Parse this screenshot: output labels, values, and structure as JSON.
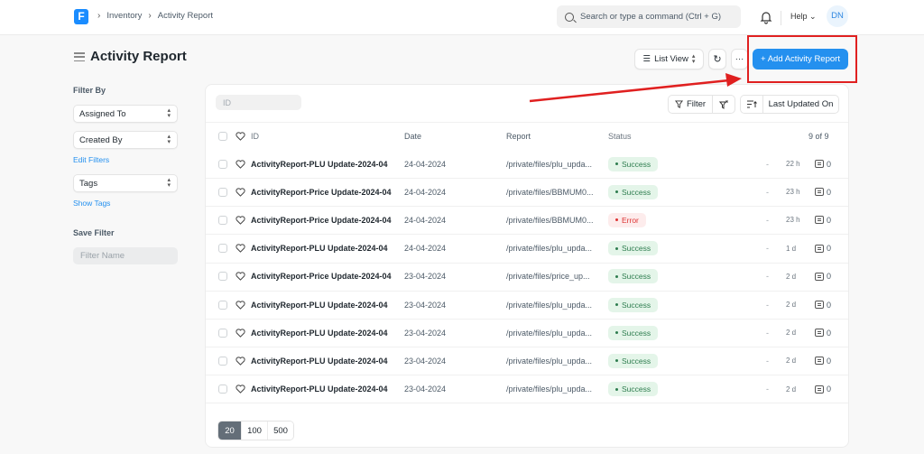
{
  "navbar": {
    "logo_letter": "F",
    "breadcrumbs": [
      "Inventory",
      "Activity Report"
    ],
    "search_placeholder": "Search or type a command (Ctrl + G)",
    "help_label": "Help",
    "avatar_initials": "DN"
  },
  "header": {
    "title": "Activity Report",
    "list_view_label": "List View",
    "more_label": "···",
    "add_button_label": "+ Add Activity Report"
  },
  "sidebar": {
    "filter_by_label": "Filter By",
    "assigned_to": "Assigned To",
    "created_by": "Created By",
    "edit_filters": "Edit Filters",
    "tags": "Tags",
    "show_tags": "Show Tags",
    "save_filter_label": "Save Filter",
    "filter_name_placeholder": "Filter Name"
  },
  "toolbar": {
    "id_placeholder": "ID",
    "filter_label": "Filter",
    "sort_label": "Last Updated On"
  },
  "table": {
    "columns": {
      "id": "ID",
      "date": "Date",
      "report": "Report",
      "status": "Status"
    },
    "count": "9 of 9",
    "rows": [
      {
        "id": "ActivityReport-PLU Update-2024-04",
        "date": "24-04-2024",
        "report": "/private/files/plu_upda...",
        "status": "Success",
        "dash": "-",
        "age": "22 h",
        "comments": "0"
      },
      {
        "id": "ActivityReport-Price Update-2024-04",
        "date": "24-04-2024",
        "report": "/private/files/BBMUM0...",
        "status": "Success",
        "dash": "-",
        "age": "23 h",
        "comments": "0"
      },
      {
        "id": "ActivityReport-Price Update-2024-04",
        "date": "24-04-2024",
        "report": "/private/files/BBMUM0...",
        "status": "Error",
        "dash": "-",
        "age": "23 h",
        "comments": "0"
      },
      {
        "id": "ActivityReport-PLU Update-2024-04",
        "date": "24-04-2024",
        "report": "/private/files/plu_upda...",
        "status": "Success",
        "dash": "-",
        "age": "1 d",
        "comments": "0"
      },
      {
        "id": "ActivityReport-Price Update-2024-04",
        "date": "23-04-2024",
        "report": "/private/files/price_up...",
        "status": "Success",
        "dash": "-",
        "age": "2 d",
        "comments": "0"
      },
      {
        "id": "ActivityReport-PLU Update-2024-04",
        "date": "23-04-2024",
        "report": "/private/files/plu_upda...",
        "status": "Success",
        "dash": "-",
        "age": "2 d",
        "comments": "0"
      },
      {
        "id": "ActivityReport-PLU Update-2024-04",
        "date": "23-04-2024",
        "report": "/private/files/plu_upda...",
        "status": "Success",
        "dash": "-",
        "age": "2 d",
        "comments": "0"
      },
      {
        "id": "ActivityReport-PLU Update-2024-04",
        "date": "23-04-2024",
        "report": "/private/files/plu_upda...",
        "status": "Success",
        "dash": "-",
        "age": "2 d",
        "comments": "0"
      },
      {
        "id": "ActivityReport-PLU Update-2024-04",
        "date": "23-04-2024",
        "report": "/private/files/plu_upda...",
        "status": "Success",
        "dash": "-",
        "age": "2 d",
        "comments": "0"
      }
    ]
  },
  "pagination": {
    "options": [
      "20",
      "100",
      "500"
    ],
    "active": "20"
  },
  "annotation": {
    "highlight_color": "#e02020"
  },
  "colors": {
    "primary": "#2490ef",
    "success_bg": "#e4f5e9",
    "success_text": "#2e7d4f",
    "error_bg": "#fdecec",
    "error_text": "#dd3333"
  }
}
